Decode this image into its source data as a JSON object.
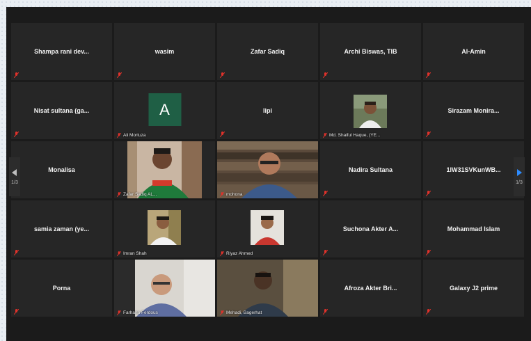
{
  "tiles": [
    {
      "name": "Shampa rani dev...",
      "type": "name"
    },
    {
      "name": "wasim",
      "type": "name"
    },
    {
      "name": "Zafar Sadiq",
      "type": "name"
    },
    {
      "name": "Archi Biswas, TIB",
      "type": "name"
    },
    {
      "name": "Al-Amin",
      "type": "name"
    },
    {
      "name": "Nisat sultana (ga...",
      "type": "name"
    },
    {
      "name": "Ali Mortuza",
      "type": "avatar",
      "initial": "A"
    },
    {
      "name": "lipi",
      "type": "name"
    },
    {
      "name": "Md. Shaiful Haque, (YE...",
      "type": "video"
    },
    {
      "name": "Sirazam Monira...",
      "type": "name"
    },
    {
      "name": "Monalisa",
      "type": "name"
    },
    {
      "name": "Zafar Sadiq AL...",
      "type": "video"
    },
    {
      "name": "mohona",
      "type": "video"
    },
    {
      "name": "Nadira Sultana",
      "type": "name"
    },
    {
      "name": "1lW31SVKunWB...",
      "type": "name"
    },
    {
      "name": "samia zaman (ye...",
      "type": "name"
    },
    {
      "name": "Imran Shah",
      "type": "video"
    },
    {
      "name": "Riyaz Ahmed",
      "type": "video"
    },
    {
      "name": "Suchona Akter A...",
      "type": "name"
    },
    {
      "name": "Mohammad Islam",
      "type": "name"
    },
    {
      "name": "Porna",
      "type": "name"
    },
    {
      "name": "Farhana Ferdous",
      "type": "video"
    },
    {
      "name": "Mehadi, Bagerhat",
      "type": "video"
    },
    {
      "name": "Afroza Akter Bri...",
      "type": "name"
    },
    {
      "name": "Galaxy J2 prime",
      "type": "name"
    }
  ],
  "pager": {
    "left_label": "1/3",
    "right_label": "1/3"
  },
  "icons": {
    "muted": "muted-mic-icon"
  },
  "colors": {
    "muted": "#e0322b",
    "active_speaker": "#c9db6a",
    "avatar_bg": "#1f5f45"
  }
}
